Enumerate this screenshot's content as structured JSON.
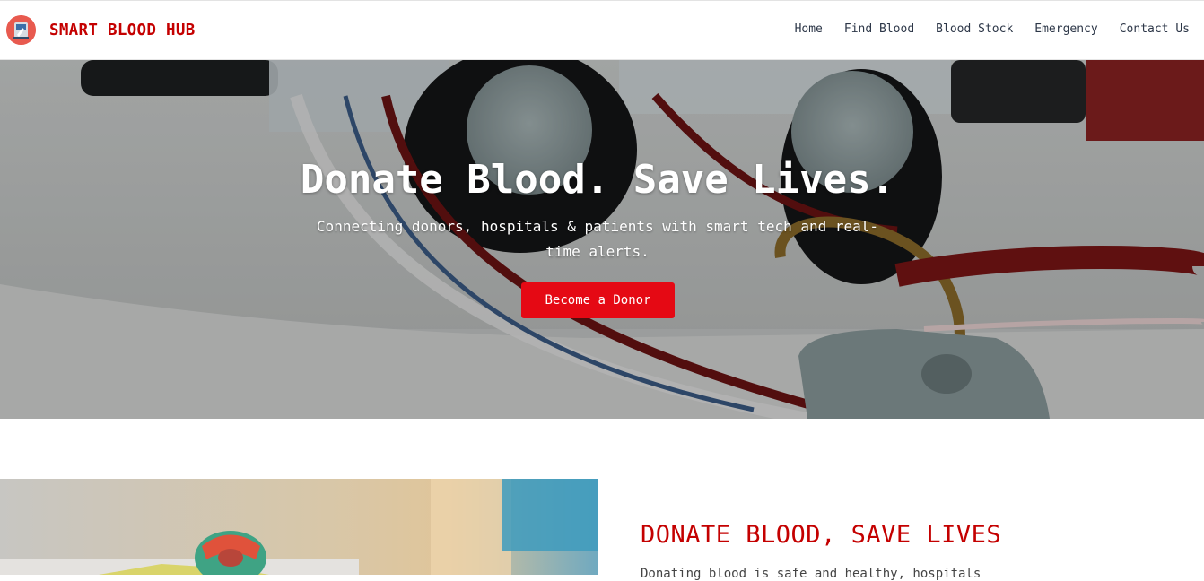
{
  "brand": {
    "name": "SMART BLOOD HUB",
    "logo_icon": "blood-bag-icon",
    "accent_color": "#c40000"
  },
  "nav": {
    "items": [
      {
        "label": "Home"
      },
      {
        "label": "Find Blood"
      },
      {
        "label": "Blood Stock"
      },
      {
        "label": "Emergency"
      },
      {
        "label": "Contact Us"
      }
    ]
  },
  "hero": {
    "title": "Donate Blood. Save Lives.",
    "subtitle": "Connecting donors, hospitals & patients with smart tech and real-time alerts.",
    "cta_label": "Become a Donor",
    "cta_color": "#e50914",
    "image": "blood-apheresis-machine-photo"
  },
  "about": {
    "title": "DONATE BLOOD, SAVE LIVES",
    "text_partial": "Donating blood is safe and healthy, hospitals",
    "image": "blood-sample-tube-photo"
  }
}
